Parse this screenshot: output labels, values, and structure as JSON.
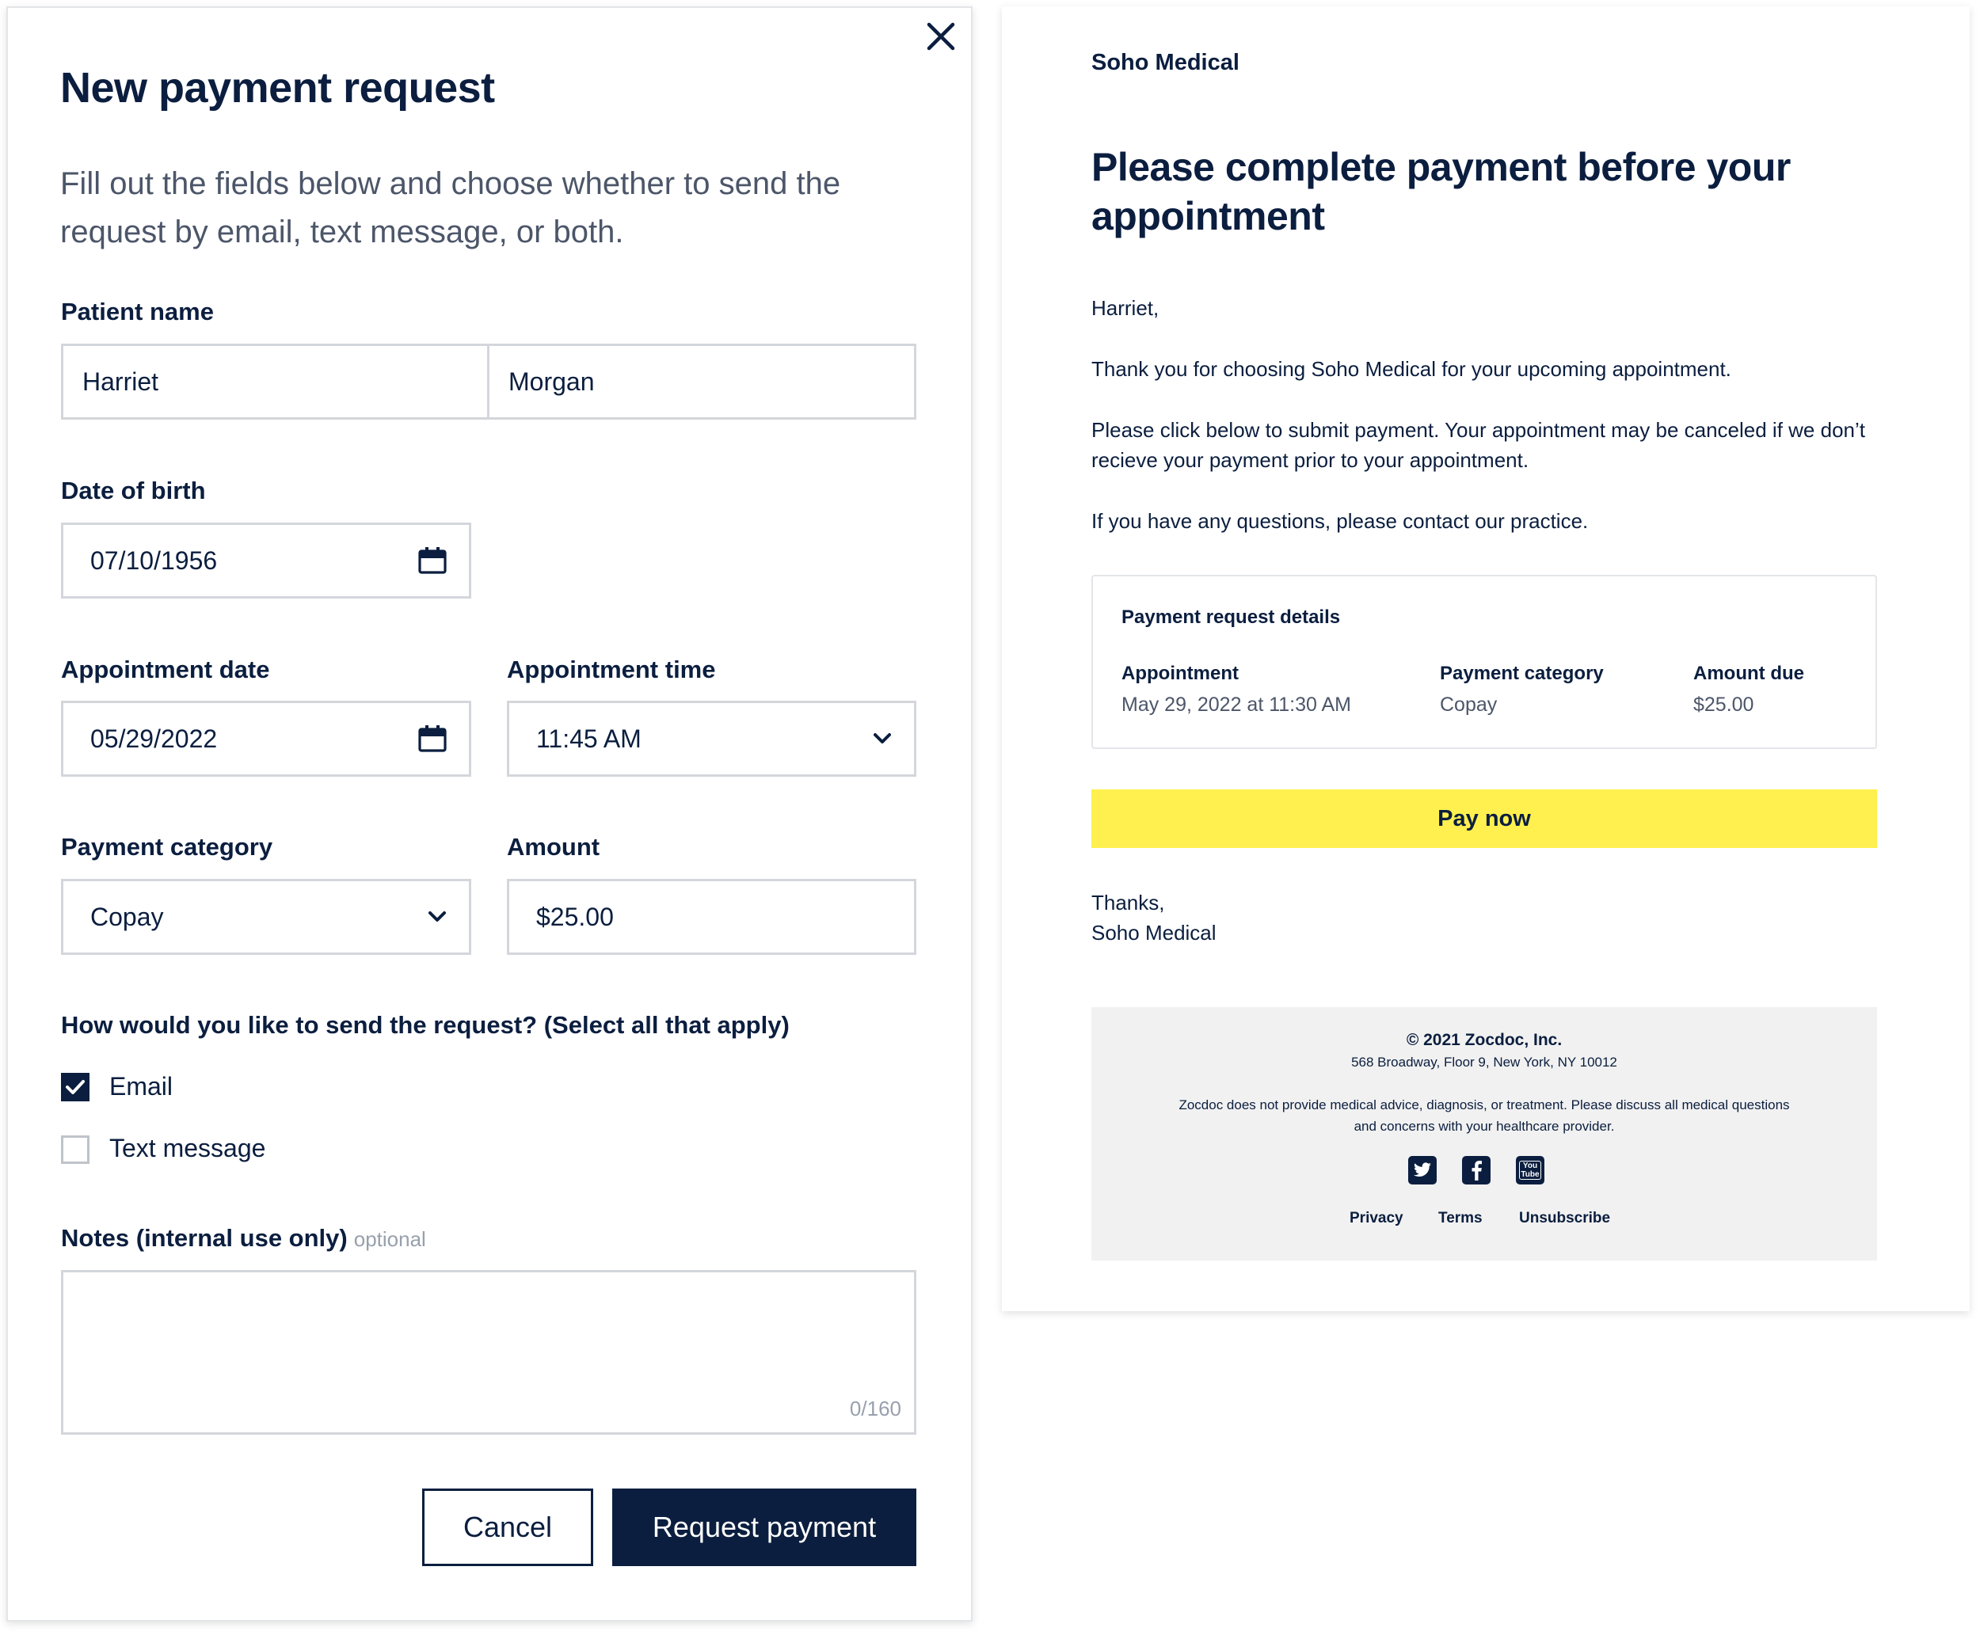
{
  "modal": {
    "title": "New payment request",
    "description": "Fill out the fields below and choose whether to send the request by email, text message, or both.",
    "patient_name_label": "Patient name",
    "first_name": "Harriet",
    "last_name": "Morgan",
    "dob_label": "Date of birth",
    "dob_value": "07/10/1956",
    "appt_date_label": "Appointment date",
    "appt_date_value": "05/29/2022",
    "appt_time_label": "Appointment time",
    "appt_time_value": "11:45 AM",
    "payment_category_label": "Payment category",
    "payment_category_value": "Copay",
    "amount_label": "Amount",
    "amount_value": "$25.00",
    "send_question": "How would you like to send the request? (Select all that apply)",
    "options": [
      {
        "label": "Email",
        "checked": true
      },
      {
        "label": "Text message",
        "checked": false
      }
    ],
    "notes_label": "Notes (internal use only)",
    "notes_optional": "optional",
    "notes_counter": "0/160",
    "cancel_label": "Cancel",
    "submit_label": "Request payment",
    "icons": {
      "close": "close-icon",
      "calendar": "calendar-icon",
      "dropdown": "chevron-down-icon",
      "check": "checkmark-icon"
    }
  },
  "email": {
    "brand": "Soho Medical",
    "title": "Please complete payment before your appointment",
    "greeting": "Harriet,",
    "para1": "Thank you for choosing Soho Medical for your upcoming appointment.",
    "para2": "Please click below to submit payment. Your appointment may be canceled if we don’t recieve your payment prior to your appointment.",
    "para3": "If you have any questions, please contact our practice.",
    "details": {
      "title": "Payment request details",
      "appointment_label": "Appointment",
      "appointment_value": "May 29, 2022 at 11:30 AM",
      "category_label": "Payment category",
      "category_value": "Copay",
      "amount_label": "Amount due",
      "amount_value": "$25.00"
    },
    "pay_button": "Pay now",
    "pay_button_color": "#fff04f",
    "signoff": "Thanks,",
    "signature": "Soho Medical",
    "footer": {
      "copyright": "© 2021 Zocdoc, Inc.",
      "address": "568 Broadway, Floor 9, New York, NY 10012",
      "disclaimer": "Zocdoc does not provide medical advice, diagnosis, or treatment. Please discuss all medical questions and concerns with your healthcare provider.",
      "social": [
        "twitter-icon",
        "facebook-icon",
        "youtube-icon"
      ],
      "youtube_text": "You Tube",
      "links": [
        "Privacy",
        "Terms",
        "Unsubscribe"
      ]
    }
  },
  "colors": {
    "navy": "#0b1e3f",
    "border": "#d3d6db",
    "muted": "#4c5669",
    "placeholder": "#98a0ad",
    "footer_bg": "#f1f1f1"
  }
}
